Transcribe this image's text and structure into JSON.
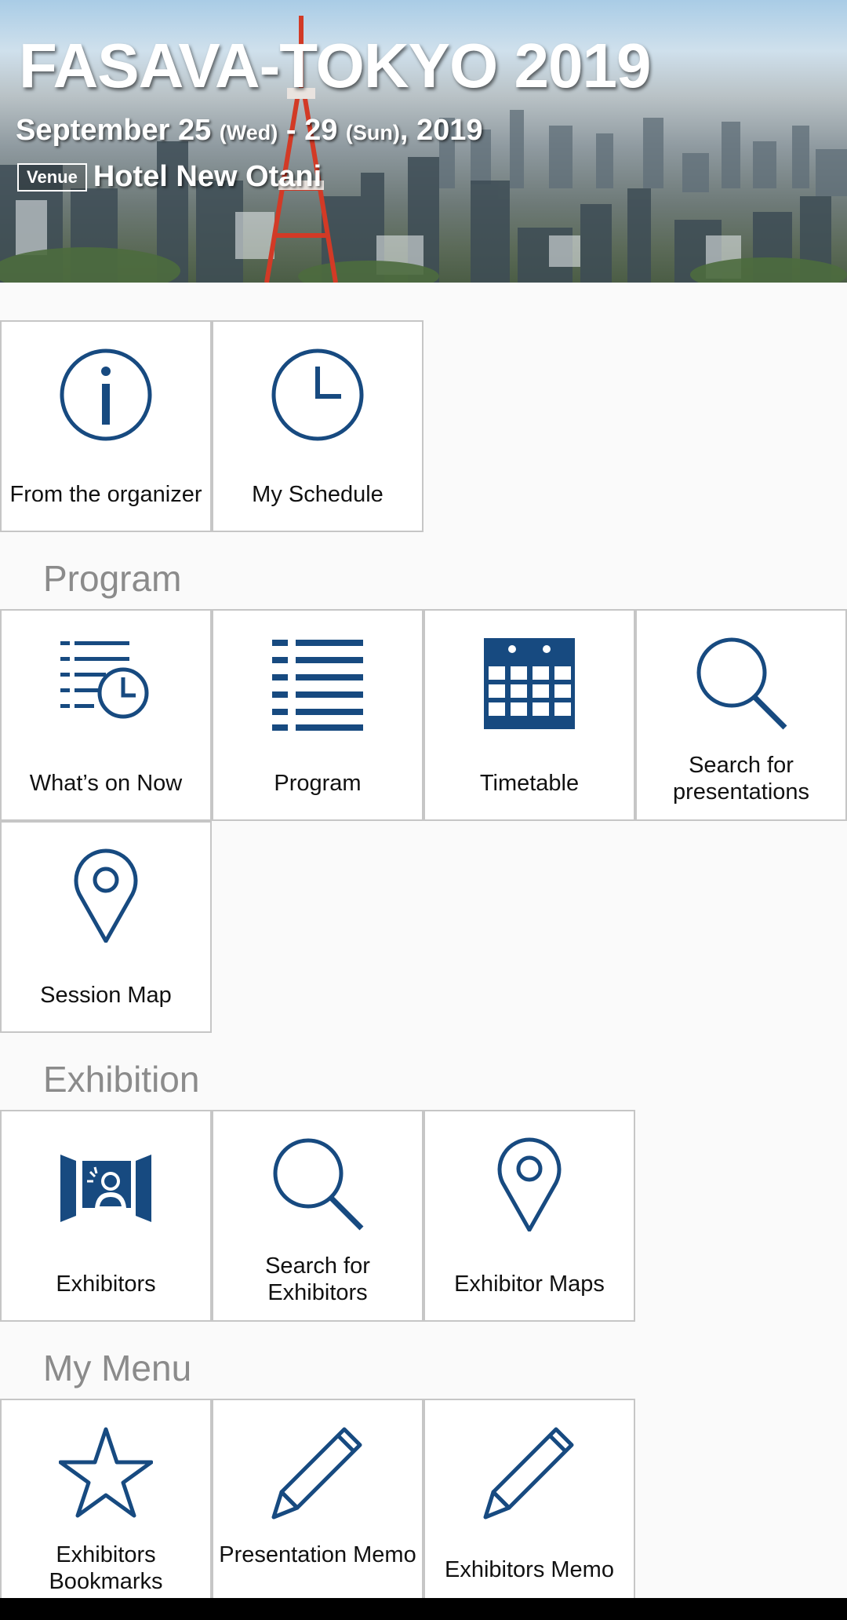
{
  "banner": {
    "title": "FASAVA-TOKYO 2019",
    "date_main": "September 25",
    "date_wed": "(Wed)",
    "date_sep": "- 29",
    "date_sun": "(Sun)",
    "date_year": ", 2019",
    "venue_tag": "Venue",
    "venue": "Hotel New Otani"
  },
  "top_tiles": [
    {
      "label": "From the organizer",
      "icon": "info-icon"
    },
    {
      "label": "My Schedule",
      "icon": "clock-icon"
    }
  ],
  "sections": {
    "program": "Program",
    "exhibition": "Exhibition",
    "my_menu": "My Menu"
  },
  "program_tiles": [
    {
      "label": "What’s on Now",
      "icon": "list-clock-icon"
    },
    {
      "label": "Program",
      "icon": "list-icon"
    },
    {
      "label": "Timetable",
      "icon": "calendar-icon"
    },
    {
      "label": "Search for presentations",
      "icon": "search-icon"
    },
    {
      "label": "Session Map",
      "icon": "map-pin-icon"
    }
  ],
  "exhibition_tiles": [
    {
      "label": "Exhibitors",
      "icon": "exhibitor-booth-icon"
    },
    {
      "label": "Search for Exhibitors",
      "icon": "search-icon"
    },
    {
      "label": "Exhibitor Maps",
      "icon": "map-pin-icon"
    }
  ],
  "mymenu_tiles": [
    {
      "label": "Exhibitors Bookmarks",
      "icon": "star-icon"
    },
    {
      "label": "Presentation Memo",
      "icon": "pencil-icon"
    },
    {
      "label": "Exhibitors Memo",
      "icon": "pencil-icon"
    }
  ],
  "colors": {
    "icon": "#174a80",
    "heading": "#8b8b8b",
    "tile_border": "#c6c6c6"
  }
}
